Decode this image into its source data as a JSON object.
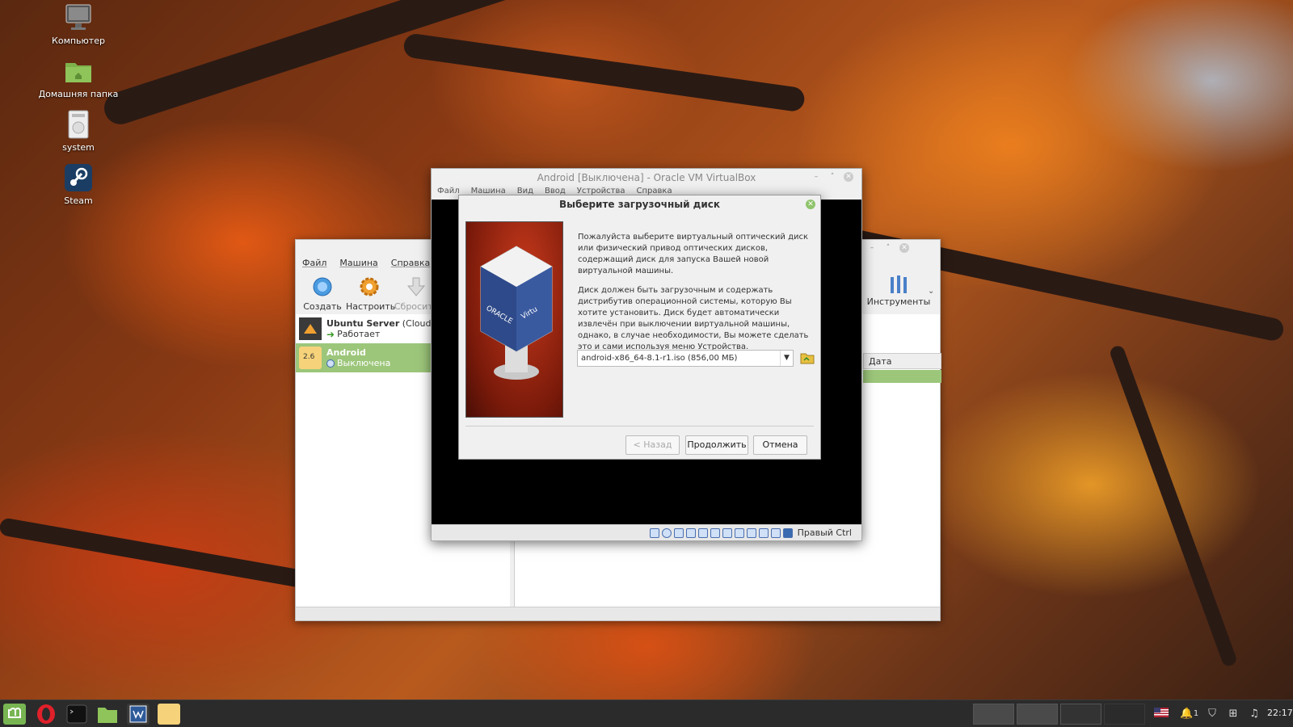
{
  "desktop": {
    "icons": [
      {
        "label": "Компьютер"
      },
      {
        "label": "Домашняя папка"
      },
      {
        "label": "system"
      },
      {
        "label": "Steam"
      }
    ]
  },
  "manager": {
    "menu": [
      "Файл",
      "Машина",
      "Справка"
    ],
    "toolbar": [
      "Создать",
      "Настроить",
      "Сбросить"
    ],
    "tools_label": "Инструменты",
    "date_column": "Дата создания",
    "vms": [
      {
        "name": "Ubuntu Server",
        "suffix": "(Cloud)",
        "status": "Работает"
      },
      {
        "name": "Android",
        "badge": "2.6",
        "status": "Выключена"
      }
    ]
  },
  "vm_window": {
    "title": "Android [Выключена] - Oracle VM VirtualBox",
    "menu": [
      "Файл",
      "Машина",
      "Вид",
      "Ввод",
      "Устройства",
      "Справка"
    ],
    "host_key": "Правый Ctrl"
  },
  "dialog": {
    "title": "Выберите загрузочный диск",
    "paragraph1": "Пожалуйста выберите виртуальный оптический диск или физический привод оптических дисков, содержащий диск для запуска Вашей новой виртуальной машины.",
    "paragraph2": "Диск должен быть загрузочным и содержать дистрибутив операционной системы, которую Вы хотите установить. Диск будет автоматически извлечён при выключении виртуальной машины, однако, в случае необходимости, Вы можете сделать это и сами используя меню Устройства.",
    "disk_value": "android-x86_64-8.1-r1.iso (856,00 МБ)",
    "back_label": "< Назад",
    "next_label": "Продолжить",
    "cancel_label": "Отмена",
    "image_text": [
      "ORACLE",
      "Virtu"
    ]
  },
  "taskbar": {
    "tray_count": "1",
    "clock": "22:17"
  }
}
